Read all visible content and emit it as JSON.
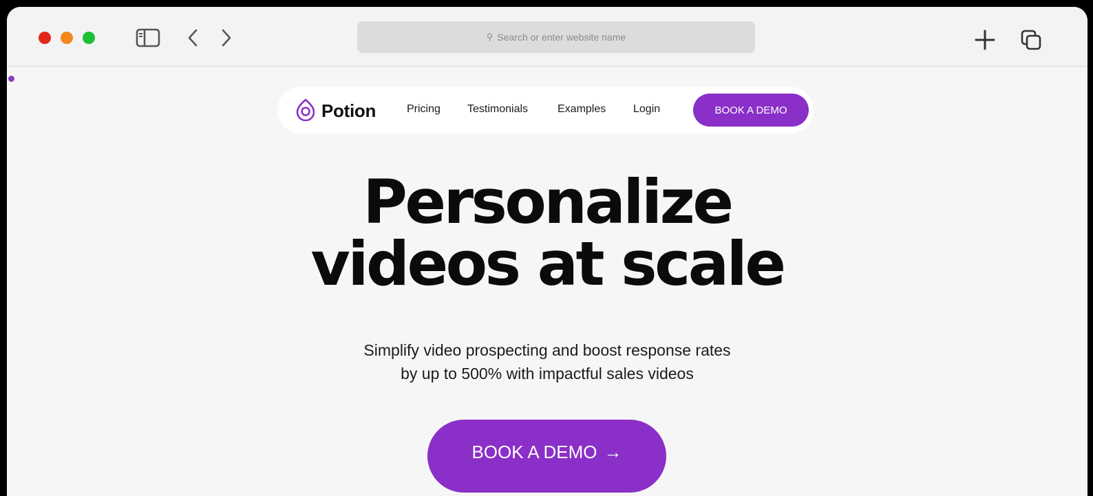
{
  "browser": {
    "address_placeholder": "Search or enter website name",
    "colors": {
      "close": "#e0271a",
      "minimize": "#f2881f",
      "maximize": "#1fbf35"
    },
    "icons": [
      "sidebar-icon",
      "back-icon",
      "forward-icon",
      "search-icon",
      "new-tab-icon",
      "tabs-overview-icon"
    ]
  },
  "site": {
    "brand": "Potion",
    "accent_color": "#8a2fc7",
    "nav": {
      "links": [
        "Pricing",
        "Testimonials",
        "Examples",
        "Login"
      ],
      "cta": "BOOK A DEMO"
    },
    "hero": {
      "headline_line1": "Personalize",
      "headline_line2": "videos at scale",
      "sub_line1": "Simplify video prospecting and boost response rates",
      "sub_line2": "by up to 500% with impactful sales videos",
      "cta": "BOOK A DEMO"
    }
  }
}
